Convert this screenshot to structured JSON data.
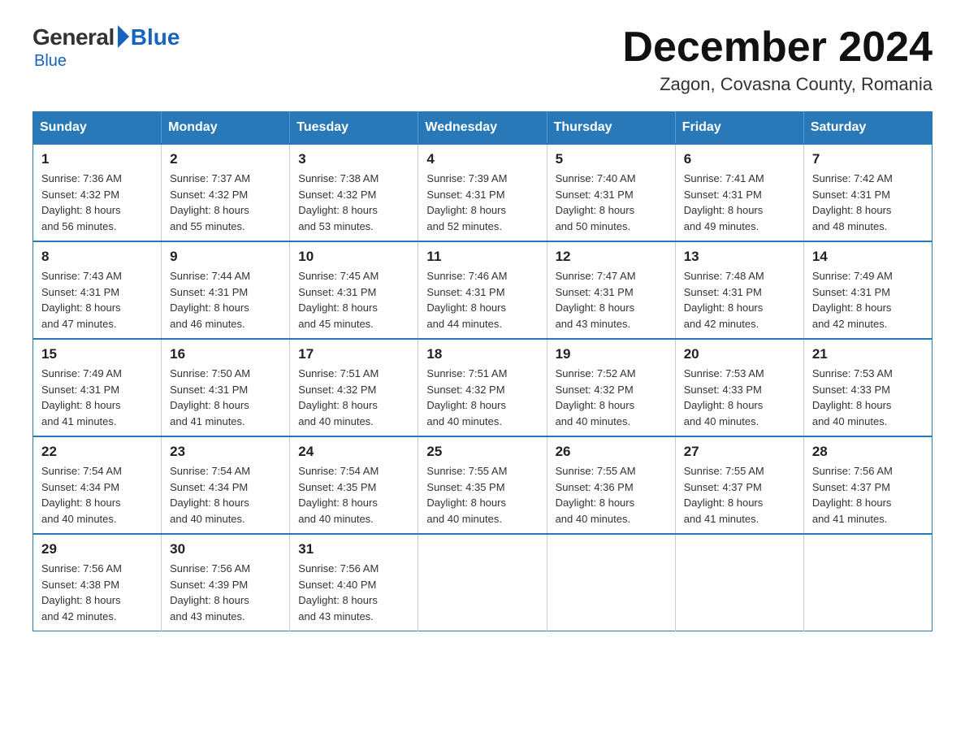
{
  "header": {
    "logo": {
      "general": "General",
      "blue": "Blue"
    },
    "month": "December 2024",
    "location": "Zagon, Covasna County, Romania"
  },
  "days_of_week": [
    "Sunday",
    "Monday",
    "Tuesday",
    "Wednesday",
    "Thursday",
    "Friday",
    "Saturday"
  ],
  "weeks": [
    [
      {
        "day": "1",
        "sunrise": "7:36 AM",
        "sunset": "4:32 PM",
        "daylight": "8 hours and 56 minutes."
      },
      {
        "day": "2",
        "sunrise": "7:37 AM",
        "sunset": "4:32 PM",
        "daylight": "8 hours and 55 minutes."
      },
      {
        "day": "3",
        "sunrise": "7:38 AM",
        "sunset": "4:32 PM",
        "daylight": "8 hours and 53 minutes."
      },
      {
        "day": "4",
        "sunrise": "7:39 AM",
        "sunset": "4:31 PM",
        "daylight": "8 hours and 52 minutes."
      },
      {
        "day": "5",
        "sunrise": "7:40 AM",
        "sunset": "4:31 PM",
        "daylight": "8 hours and 50 minutes."
      },
      {
        "day": "6",
        "sunrise": "7:41 AM",
        "sunset": "4:31 PM",
        "daylight": "8 hours and 49 minutes."
      },
      {
        "day": "7",
        "sunrise": "7:42 AM",
        "sunset": "4:31 PM",
        "daylight": "8 hours and 48 minutes."
      }
    ],
    [
      {
        "day": "8",
        "sunrise": "7:43 AM",
        "sunset": "4:31 PM",
        "daylight": "8 hours and 47 minutes."
      },
      {
        "day": "9",
        "sunrise": "7:44 AM",
        "sunset": "4:31 PM",
        "daylight": "8 hours and 46 minutes."
      },
      {
        "day": "10",
        "sunrise": "7:45 AM",
        "sunset": "4:31 PM",
        "daylight": "8 hours and 45 minutes."
      },
      {
        "day": "11",
        "sunrise": "7:46 AM",
        "sunset": "4:31 PM",
        "daylight": "8 hours and 44 minutes."
      },
      {
        "day": "12",
        "sunrise": "7:47 AM",
        "sunset": "4:31 PM",
        "daylight": "8 hours and 43 minutes."
      },
      {
        "day": "13",
        "sunrise": "7:48 AM",
        "sunset": "4:31 PM",
        "daylight": "8 hours and 42 minutes."
      },
      {
        "day": "14",
        "sunrise": "7:49 AM",
        "sunset": "4:31 PM",
        "daylight": "8 hours and 42 minutes."
      }
    ],
    [
      {
        "day": "15",
        "sunrise": "7:49 AM",
        "sunset": "4:31 PM",
        "daylight": "8 hours and 41 minutes."
      },
      {
        "day": "16",
        "sunrise": "7:50 AM",
        "sunset": "4:31 PM",
        "daylight": "8 hours and 41 minutes."
      },
      {
        "day": "17",
        "sunrise": "7:51 AM",
        "sunset": "4:32 PM",
        "daylight": "8 hours and 40 minutes."
      },
      {
        "day": "18",
        "sunrise": "7:51 AM",
        "sunset": "4:32 PM",
        "daylight": "8 hours and 40 minutes."
      },
      {
        "day": "19",
        "sunrise": "7:52 AM",
        "sunset": "4:32 PM",
        "daylight": "8 hours and 40 minutes."
      },
      {
        "day": "20",
        "sunrise": "7:53 AM",
        "sunset": "4:33 PM",
        "daylight": "8 hours and 40 minutes."
      },
      {
        "day": "21",
        "sunrise": "7:53 AM",
        "sunset": "4:33 PM",
        "daylight": "8 hours and 40 minutes."
      }
    ],
    [
      {
        "day": "22",
        "sunrise": "7:54 AM",
        "sunset": "4:34 PM",
        "daylight": "8 hours and 40 minutes."
      },
      {
        "day": "23",
        "sunrise": "7:54 AM",
        "sunset": "4:34 PM",
        "daylight": "8 hours and 40 minutes."
      },
      {
        "day": "24",
        "sunrise": "7:54 AM",
        "sunset": "4:35 PM",
        "daylight": "8 hours and 40 minutes."
      },
      {
        "day": "25",
        "sunrise": "7:55 AM",
        "sunset": "4:35 PM",
        "daylight": "8 hours and 40 minutes."
      },
      {
        "day": "26",
        "sunrise": "7:55 AM",
        "sunset": "4:36 PM",
        "daylight": "8 hours and 40 minutes."
      },
      {
        "day": "27",
        "sunrise": "7:55 AM",
        "sunset": "4:37 PM",
        "daylight": "8 hours and 41 minutes."
      },
      {
        "day": "28",
        "sunrise": "7:56 AM",
        "sunset": "4:37 PM",
        "daylight": "8 hours and 41 minutes."
      }
    ],
    [
      {
        "day": "29",
        "sunrise": "7:56 AM",
        "sunset": "4:38 PM",
        "daylight": "8 hours and 42 minutes."
      },
      {
        "day": "30",
        "sunrise": "7:56 AM",
        "sunset": "4:39 PM",
        "daylight": "8 hours and 43 minutes."
      },
      {
        "day": "31",
        "sunrise": "7:56 AM",
        "sunset": "4:40 PM",
        "daylight": "8 hours and 43 minutes."
      },
      null,
      null,
      null,
      null
    ]
  ],
  "labels": {
    "sunrise": "Sunrise:",
    "sunset": "Sunset:",
    "daylight": "Daylight:"
  }
}
